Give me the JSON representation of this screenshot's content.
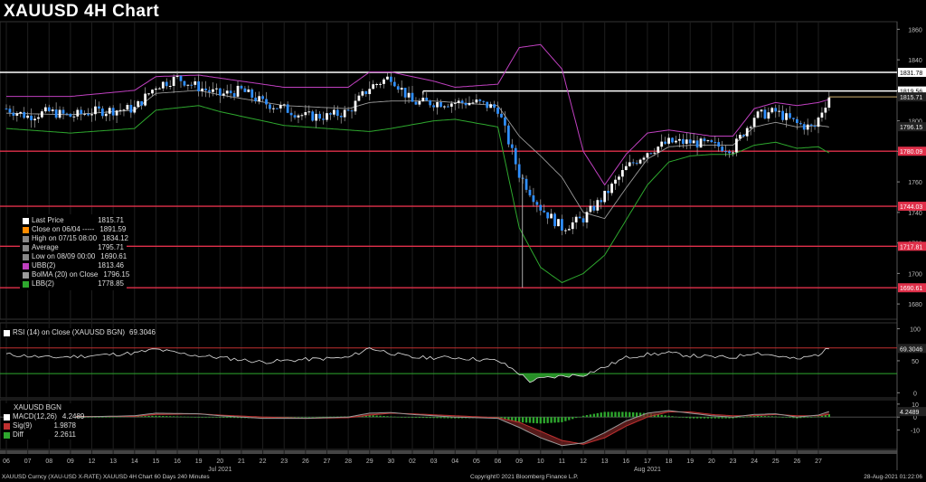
{
  "title": "XAUUSD 4H Chart",
  "colors": {
    "bg": "#000000",
    "up": "#ffffff",
    "down": "#2f8fff",
    "ubb": "#c040c0",
    "lbb": "#2ea82e",
    "mid": "#9a9a9a",
    "hline_red": "#e0304a",
    "hline_white": "#ffffff",
    "rsi": "#e0e0e0",
    "macd": "#9a9a9a",
    "sig": "#c03030",
    "diff": "#2ea82e",
    "last": "#d0b070"
  },
  "legend": {
    "items": [
      {
        "label": "Last Price",
        "value": "1815.71",
        "color": "#ffffff",
        "icon": "white-square-icon"
      },
      {
        "label": "Close on 06/04",
        "value": "1891.59",
        "color": "#ff8c00",
        "icon": "orange-square-icon",
        "dashes": "-----"
      },
      {
        "label": "High on 07/15 08:00",
        "value": "1834.12",
        "color": "#888888",
        "icon": "high-marker-icon"
      },
      {
        "label": "Average",
        "value": "1795.71",
        "color": "#888888",
        "icon": "average-marker-icon"
      },
      {
        "label": "Low on 08/09 00:00",
        "value": "1690.61",
        "color": "#888888",
        "icon": "low-marker-icon"
      },
      {
        "label": "UBB(2)",
        "value": "1813.46",
        "color": "#c040c0",
        "icon": "magenta-square-icon"
      },
      {
        "label": "BolMA (20)  on Close",
        "value": "1796.15",
        "color": "#9a9a9a",
        "icon": "gray-square-icon"
      },
      {
        "label": "LBB(2)",
        "value": "1778.85",
        "color": "#2ea82e",
        "icon": "green-square-icon"
      }
    ]
  },
  "rsi_legend": {
    "label": "RSI (14)  on Close (XAUUSD BGN)",
    "value": "69.3046"
  },
  "macd_legend": {
    "title": "XAUUSD BGN",
    "items": [
      {
        "label": "MACD(12,26)",
        "value": "4.2489",
        "color": "#ffffff"
      },
      {
        "label": "Sig(9)",
        "value": "1.9878",
        "color": "#c03030"
      },
      {
        "label": "Diff",
        "value": "2.2611",
        "color": "#2ea82e"
      }
    ]
  },
  "footer": {
    "left": "XAUUSD Curncy (XAU-USD X-RATE) XAUUSD 4H Chart 60 Days 240 Minutes",
    "center": "Copyright© 2021 Bloomberg Finance L.P.",
    "right": "28-Aug-2021 01:22:06"
  },
  "chart_data": {
    "type": "candlestick",
    "title": "XAUUSD 4H Chart",
    "ylim": [
      1670,
      1862
    ],
    "y_ticks": [
      1680,
      1700,
      1720,
      1740,
      1760,
      1780,
      1800,
      1820,
      1840,
      1860
    ],
    "y_tick_labels": [
      "1680",
      "1700",
      "1720",
      "1740",
      "1760",
      "1780",
      "1800",
      "1820",
      "1840",
      "1860"
    ],
    "x_day_labels": [
      "06",
      "07",
      "08",
      "09",
      "12",
      "13",
      "14",
      "15",
      "16",
      "19",
      "20",
      "21",
      "22",
      "23",
      "26",
      "27",
      "28",
      "29",
      "30",
      "02",
      "03",
      "04",
      "05",
      "06",
      "09",
      "10",
      "11",
      "12",
      "13",
      "16",
      "17",
      "18",
      "19",
      "20",
      "23",
      "24",
      "25",
      "26",
      "27"
    ],
    "x_month_labels": [
      {
        "label": "Jul 2021",
        "day_index": 10
      },
      {
        "label": "Aug 2021",
        "day_index": 30
      }
    ],
    "horizontal_levels": [
      {
        "value": 1831.78,
        "label": "1831.78",
        "color": "#ffffff"
      },
      {
        "value": 1819.56,
        "label": "1819.56",
        "color": "#ffffff",
        "from_day_index": 19.5
      },
      {
        "value": 1780.09,
        "label": "1780.09",
        "color": "#e0304a"
      },
      {
        "value": 1744.03,
        "label": "1744.03",
        "color": "#e0304a"
      },
      {
        "value": 1717.81,
        "label": "1717.81",
        "color": "#e0304a"
      },
      {
        "value": 1690.61,
        "label": "1690.61",
        "color": "#e0304a"
      }
    ],
    "axis_value_labels": [
      {
        "value": 1815.71,
        "label": "1815.71"
      },
      {
        "value": 1796.15,
        "label": "1796.15"
      }
    ],
    "last_price": 1815.71,
    "anchors_close": [
      [
        0,
        1808
      ],
      [
        1,
        1803
      ],
      [
        2,
        1806
      ],
      [
        3,
        1803
      ],
      [
        4,
        1806
      ],
      [
        5,
        1807
      ],
      [
        6,
        1808
      ],
      [
        7,
        1823
      ],
      [
        8,
        1828
      ],
      [
        9,
        1822
      ],
      [
        10,
        1817
      ],
      [
        11,
        1820
      ],
      [
        12,
        1812
      ],
      [
        13,
        1808
      ],
      [
        14,
        1803
      ],
      [
        15,
        1803
      ],
      [
        16,
        1806
      ],
      [
        17,
        1822
      ],
      [
        18,
        1829
      ],
      [
        19,
        1812
      ],
      [
        20,
        1812
      ],
      [
        21,
        1812
      ],
      [
        22,
        1812
      ],
      [
        23,
        1808
      ],
      [
        24,
        1765
      ],
      [
        25,
        1743
      ],
      [
        26,
        1730
      ],
      [
        27,
        1736
      ],
      [
        28,
        1751
      ],
      [
        29,
        1769
      ],
      [
        30,
        1780
      ],
      [
        31,
        1786
      ],
      [
        32,
        1786
      ],
      [
        33,
        1784
      ],
      [
        34,
        1782
      ],
      [
        35,
        1803
      ],
      [
        36,
        1806
      ],
      [
        37,
        1798
      ],
      [
        37.8,
        1795
      ],
      [
        38.1,
        1805
      ],
      [
        38.5,
        1816
      ]
    ],
    "ubb_anchors": [
      [
        0,
        1816
      ],
      [
        3,
        1816
      ],
      [
        6,
        1820
      ],
      [
        7,
        1829
      ],
      [
        9,
        1830
      ],
      [
        10,
        1828
      ],
      [
        13,
        1822
      ],
      [
        16,
        1822
      ],
      [
        17,
        1832
      ],
      [
        18,
        1832
      ],
      [
        20,
        1826
      ],
      [
        21,
        1822
      ],
      [
        23,
        1824
      ],
      [
        24,
        1848
      ],
      [
        25,
        1850
      ],
      [
        26,
        1834
      ],
      [
        27,
        1780
      ],
      [
        28,
        1758
      ],
      [
        29,
        1778
      ],
      [
        30,
        1792
      ],
      [
        31,
        1794
      ],
      [
        32,
        1792
      ],
      [
        33,
        1790
      ],
      [
        34,
        1790
      ],
      [
        35,
        1808
      ],
      [
        36,
        1812
      ],
      [
        37,
        1810
      ],
      [
        38,
        1812
      ],
      [
        38.5,
        1814
      ]
    ],
    "lbb_anchors": [
      [
        0,
        1795
      ],
      [
        3,
        1792
      ],
      [
        6,
        1795
      ],
      [
        7,
        1807
      ],
      [
        9,
        1810
      ],
      [
        10,
        1806
      ],
      [
        13,
        1797
      ],
      [
        16,
        1794
      ],
      [
        17,
        1793
      ],
      [
        18,
        1795
      ],
      [
        20,
        1800
      ],
      [
        21,
        1801
      ],
      [
        23,
        1796
      ],
      [
        24,
        1730
      ],
      [
        25,
        1704
      ],
      [
        26,
        1694
      ],
      [
        27,
        1700
      ],
      [
        28,
        1712
      ],
      [
        29,
        1735
      ],
      [
        30,
        1758
      ],
      [
        31,
        1773
      ],
      [
        32,
        1777
      ],
      [
        33,
        1778
      ],
      [
        34,
        1778
      ],
      [
        35,
        1784
      ],
      [
        36,
        1786
      ],
      [
        37,
        1782
      ],
      [
        38,
        1783
      ],
      [
        38.5,
        1779
      ]
    ],
    "mid_anchors": [
      [
        0,
        1805
      ],
      [
        3,
        1804
      ],
      [
        6,
        1807
      ],
      [
        7,
        1818
      ],
      [
        9,
        1820
      ],
      [
        10,
        1817
      ],
      [
        13,
        1810
      ],
      [
        16,
        1808
      ],
      [
        17,
        1812
      ],
      [
        18,
        1813
      ],
      [
        20,
        1813
      ],
      [
        21,
        1812
      ],
      [
        23,
        1810
      ],
      [
        24,
        1790
      ],
      [
        25,
        1777
      ],
      [
        26,
        1763
      ],
      [
        27,
        1740
      ],
      [
        28,
        1736
      ],
      [
        29,
        1756
      ],
      [
        30,
        1775
      ],
      [
        31,
        1783
      ],
      [
        32,
        1784
      ],
      [
        33,
        1784
      ],
      [
        34,
        1784
      ],
      [
        35,
        1796
      ],
      [
        36,
        1799
      ],
      [
        37,
        1796
      ],
      [
        38,
        1797
      ],
      [
        38.5,
        1796
      ]
    ],
    "rsi": {
      "ylim": [
        -8,
        105
      ],
      "y_ticks": [
        0,
        50,
        100
      ],
      "y_tick_labels": [
        "0",
        "50",
        "100"
      ],
      "overbought": 70,
      "oversold": 30,
      "last_value": 69.3046,
      "last_label": "69.3046",
      "anchors": [
        [
          0,
          60
        ],
        [
          2,
          55
        ],
        [
          4,
          58
        ],
        [
          6,
          62
        ],
        [
          7,
          68
        ],
        [
          8,
          62
        ],
        [
          9,
          58
        ],
        [
          10,
          55
        ],
        [
          12,
          48
        ],
        [
          14,
          52
        ],
        [
          16,
          55
        ],
        [
          17,
          70
        ],
        [
          18,
          62
        ],
        [
          19,
          55
        ],
        [
          21,
          55
        ],
        [
          23,
          50
        ],
        [
          23.8,
          35
        ],
        [
          24.5,
          18
        ],
        [
          25,
          22
        ],
        [
          26,
          26
        ],
        [
          27,
          28
        ],
        [
          28,
          40
        ],
        [
          29,
          55
        ],
        [
          30,
          60
        ],
        [
          31,
          62
        ],
        [
          32,
          58
        ],
        [
          33,
          56
        ],
        [
          34,
          55
        ],
        [
          35,
          63
        ],
        [
          36,
          58
        ],
        [
          37,
          52
        ],
        [
          38,
          60
        ],
        [
          38.5,
          69.3
        ]
      ]
    },
    "macd": {
      "ylim": [
        -25,
        12
      ],
      "y_ticks": [
        -10,
        0,
        10
      ],
      "y_tick_labels": [
        "-10",
        "0",
        "10"
      ],
      "last_value": 4.2489,
      "last_label": "4.2489",
      "macd_anchors": [
        [
          0,
          1
        ],
        [
          3,
          0
        ],
        [
          6,
          1
        ],
        [
          7,
          3
        ],
        [
          9,
          2.5
        ],
        [
          10,
          1
        ],
        [
          12,
          -1
        ],
        [
          14,
          -1
        ],
        [
          16,
          0
        ],
        [
          17,
          3
        ],
        [
          18,
          3.5
        ],
        [
          19,
          2
        ],
        [
          21,
          0
        ],
        [
          23,
          -1
        ],
        [
          24,
          -8
        ],
        [
          25,
          -16
        ],
        [
          26,
          -22
        ],
        [
          27,
          -20
        ],
        [
          28,
          -12
        ],
        [
          29,
          -3
        ],
        [
          30,
          3
        ],
        [
          31,
          5
        ],
        [
          32,
          3
        ],
        [
          33,
          1
        ],
        [
          34,
          0
        ],
        [
          35,
          2
        ],
        [
          36,
          2.5
        ],
        [
          37,
          0
        ],
        [
          38,
          1.5
        ],
        [
          38.5,
          4.25
        ]
      ],
      "signal_anchors": [
        [
          0,
          1
        ],
        [
          3,
          0.5
        ],
        [
          6,
          0.5
        ],
        [
          7,
          2
        ],
        [
          9,
          2.5
        ],
        [
          10,
          1.5
        ],
        [
          12,
          0
        ],
        [
          14,
          -1
        ],
        [
          16,
          -0.5
        ],
        [
          17,
          1.5
        ],
        [
          18,
          3
        ],
        [
          19,
          2.5
        ],
        [
          21,
          1
        ],
        [
          23,
          -0.5
        ],
        [
          24,
          -4
        ],
        [
          25,
          -11
        ],
        [
          26,
          -18
        ],
        [
          27,
          -21
        ],
        [
          28,
          -16
        ],
        [
          29,
          -7
        ],
        [
          30,
          0
        ],
        [
          31,
          4
        ],
        [
          32,
          4
        ],
        [
          33,
          2
        ],
        [
          34,
          1
        ],
        [
          35,
          1
        ],
        [
          36,
          2
        ],
        [
          37,
          1
        ],
        [
          38,
          1
        ],
        [
          38.5,
          1.99
        ]
      ]
    }
  }
}
